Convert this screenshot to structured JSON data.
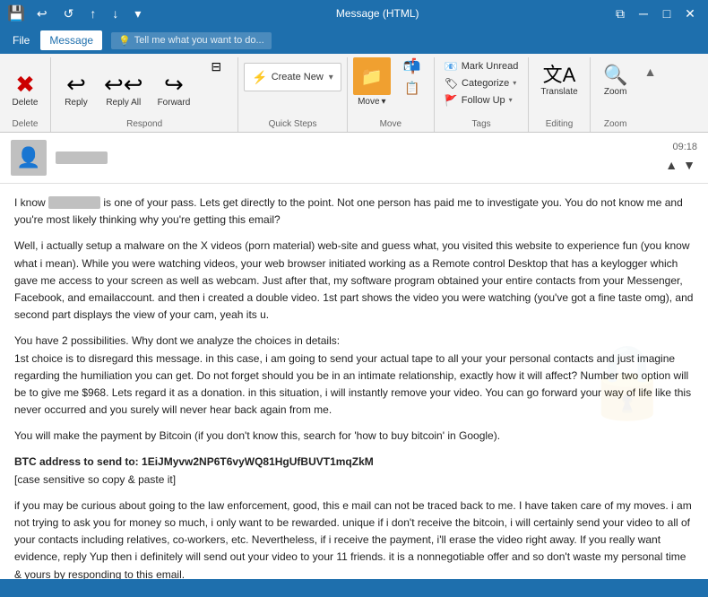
{
  "titlebar": {
    "icon": "💾",
    "title": "Message (HTML)",
    "undo": "↩",
    "redo": "↺",
    "up": "↑",
    "down": "↓",
    "more": "▾",
    "minimize": "─",
    "restore": "□",
    "close": "✕",
    "box_icon": "⧉"
  },
  "menubar": {
    "file": "File",
    "message": "Message",
    "tell_me": "Tell me what you want to do...",
    "tell_me_icon": "💡"
  },
  "ribbon": {
    "delete_group": "Delete",
    "respond_group": "Respond",
    "quick_steps_group": "Quick Steps",
    "move_group": "Move",
    "tags_group": "Tags",
    "editing_group": "Editing",
    "zoom_group": "Zoom",
    "delete_btn": "Delete",
    "reply_btn": "Reply",
    "reply_all_btn": "Reply All",
    "forward_btn": "Forward",
    "create_new_btn": "Create New",
    "move_btn": "Move",
    "move_dropdown": "▾",
    "mark_unread": "Mark Unread",
    "categorize": "Categorize",
    "follow_up": "Follow Up",
    "translate_btn": "Translate",
    "search_btn": "🔍",
    "zoom_btn": "Zoom"
  },
  "email": {
    "time": "09:18",
    "sender_placeholder": "████",
    "body_paragraphs": [
      "I know ████ is one of your pass. Lets get directly to the point. Not one person has paid me to investigate you. You do not know me and you're most likely thinking why you're getting this email?",
      "Well, i actually setup a malware on the X videos (porn material) web-site and guess what, you visited this website to experience fun (you know what i mean). While you were watching videos, your web browser initiated working as a Remote control Desktop that has a keylogger which gave me access to your screen as well as webcam. Just after that, my software program obtained your entire contacts from your Messenger, Facebook, and emailaccount. and then i created a double video. 1st part shows the video you were watching (you've got a fine taste omg), and second part displays the view of your cam, yeah its u.",
      "You have 2 possibilities. Why dont we analyze the choices in details:\n1st choice is to disregard this message. in this case, i am going to send your actual tape to all your your personal contacts and just imagine regarding the humiliation you can get. Do not forget should you be in an intimate relationship, exactly how it will affect? Number two option will be to give me $968. Lets regard it as a donation. in this situation, i will instantly remove your video. You can go forward your way of life like this never occurred and you surely will never hear back again from me.",
      "You will make the payment by Bitcoin (if you don't know this, search for 'how to buy bitcoin' in Google).",
      "BTC address to send to: 1EiJMyvw2NP6T6vyWQ81HgUfBUVT1mqZkM\n[case sensitive so copy & paste it]",
      "if you may be curious about going to the law enforcement, good, this e mail can not be traced back to me. I have taken care of my moves. i am not trying to ask you for money so much, i only want to be rewarded. unique if i don't receive the bitcoin, i will certainly send your video to all of your contacts including relatives, co-workers, etc. Nevertheless, if i receive the payment, i'll erase the video right away. If you really want evidence, reply Yup then i definitely will send out your video to your 11 friends. it is a nonnegotiable offer and so don't waste my personal time & yours by responding to this email."
    ]
  }
}
